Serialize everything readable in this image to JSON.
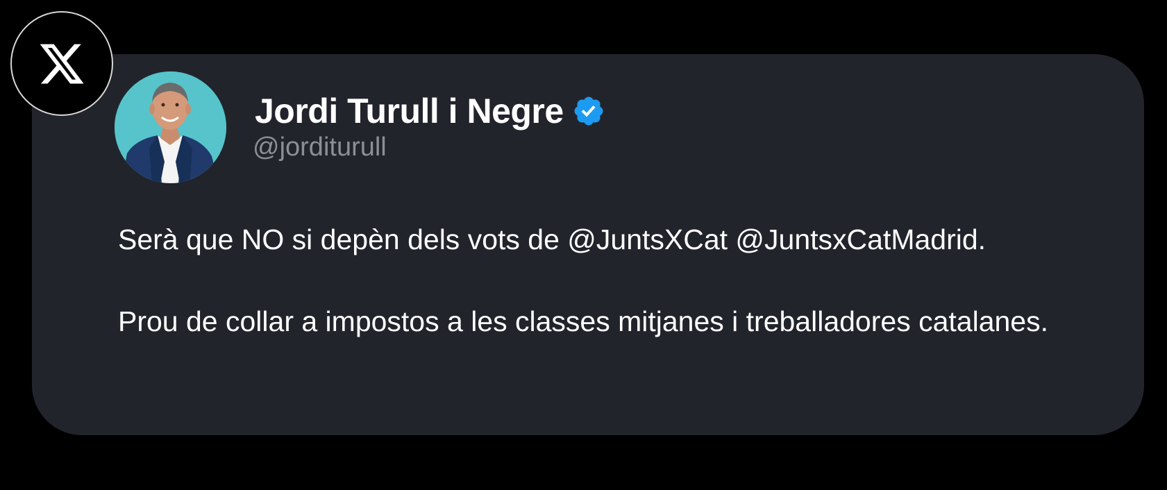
{
  "platform": {
    "logo_icon": "x-logo-icon"
  },
  "author": {
    "display_name": "Jordi Turull i Negre",
    "handle": "@jorditurull",
    "verified": true,
    "verified_icon": "verified-badge-icon",
    "verified_color": "#1d9bf0",
    "avatar_icon": "profile-photo"
  },
  "tweet": {
    "paragraphs": [
      "Serà que NO si depèn dels vots de @JuntsXCat @JuntsxCatMadrid.",
      "Prou de collar a impostos a les classes mitjanes i treballadores catalanes."
    ]
  },
  "colors": {
    "background": "#000000",
    "card": "#22242c",
    "text": "#ffffff",
    "handle": "#8b8f96"
  }
}
